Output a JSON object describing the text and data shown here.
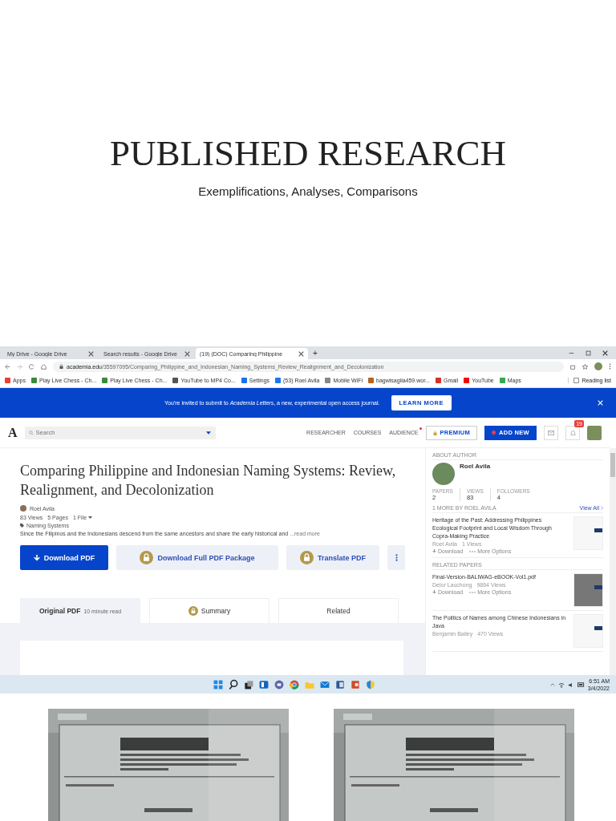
{
  "slide": {
    "title": "PUBLISHED RESEARCH",
    "subtitle": "Exemplifications, Analyses, Comparisons"
  },
  "browser": {
    "tabs": [
      {
        "title": "My Drive - Google Drive",
        "selected": false
      },
      {
        "title": "Search results - Google Drive",
        "selected": false
      },
      {
        "title": "(19) (DOC) Comparing Philippine",
        "selected": true
      }
    ],
    "new_tab": "+",
    "url_domain": "academia.edu",
    "url_path": "/35597095/Comparing_Philippine_and_Indonesian_Naming_Systems_Review_Realignment_and_Decolonization",
    "bookmarks": [
      "Apps",
      "Play Live Chess - Ch...",
      "Play Live Chess - Ch...",
      "YouTube to MP4 Co...",
      "Settings",
      "(53) Roel Avila",
      "Mobile WiFi",
      "bagwisagila459.wor...",
      "Gmail",
      "YouTube",
      "Maps"
    ],
    "reading_list": "Reading list"
  },
  "banner": {
    "text": "You're invited to submit to *Academia Letters*, a new, experimental open access journal.",
    "button": "LEARN MORE"
  },
  "header": {
    "logo": "A",
    "search_placeholder": "Search",
    "nav": [
      "RESEARCHER",
      "COURSES",
      "AUDIENCE"
    ],
    "premium": "PREMIUM",
    "add_new": "ADD NEW",
    "notifications": "19"
  },
  "paper": {
    "title": "Comparing Philippine and Indonesian Naming Systems: Review, Realignment, and Decolonization",
    "author": "Roel Avila",
    "views": "83 Views",
    "pages": "5 Pages",
    "files": "1 File",
    "tag": "Naming Systems",
    "abstract": "Since the Filipinos and the Indonesians descend from the same ancestors and share the early historical and",
    "read_more": "...read more",
    "buttons": [
      {
        "label": "Download PDF",
        "kind": "primary"
      },
      {
        "label": "Download Full PDF Package",
        "kind": "locked"
      },
      {
        "label": "Translate PDF",
        "kind": "locked"
      }
    ],
    "tabs": [
      {
        "label": "Original PDF",
        "note": "10 minute read",
        "locked": false,
        "selected": true
      },
      {
        "label": "Summary",
        "locked": true,
        "selected": false
      },
      {
        "label": "Related",
        "locked": false,
        "selected": false
      }
    ]
  },
  "sidebar": {
    "about_heading": "ABOUT AUTHOR",
    "author": "Roel Avila",
    "stats": [
      {
        "label": "PAPERS",
        "value": "2"
      },
      {
        "label": "VIEWS",
        "value": "83"
      },
      {
        "label": "FOLLOWERS",
        "value": "4"
      }
    ],
    "more_heading": "1 MORE BY ROEL AVILA",
    "view_all": "View All",
    "more_papers": [
      {
        "title": "Heritage of the Past: Addressing Philippines Ecological Footprint and Local Wisdom Through Copra-Making Practice",
        "author": "Roel Avila",
        "views": "1 Views",
        "download": "Download",
        "options": "More Options"
      }
    ],
    "related_heading": "RELATED PAPERS",
    "related_papers": [
      {
        "title": "Final-Version-BALIWAG-eBOOK-Vol1.pdf",
        "author": "Delor Lauchong",
        "views": "9864 Views",
        "download": "Download",
        "options": "More Options"
      },
      {
        "title": "The Politics of Names among Chinese Indonesians in Java",
        "author": "Benjamin Bailey",
        "views": "470 Views"
      }
    ]
  },
  "taskbar": {
    "time": "6:51 AM",
    "date": "3/4/2022"
  }
}
